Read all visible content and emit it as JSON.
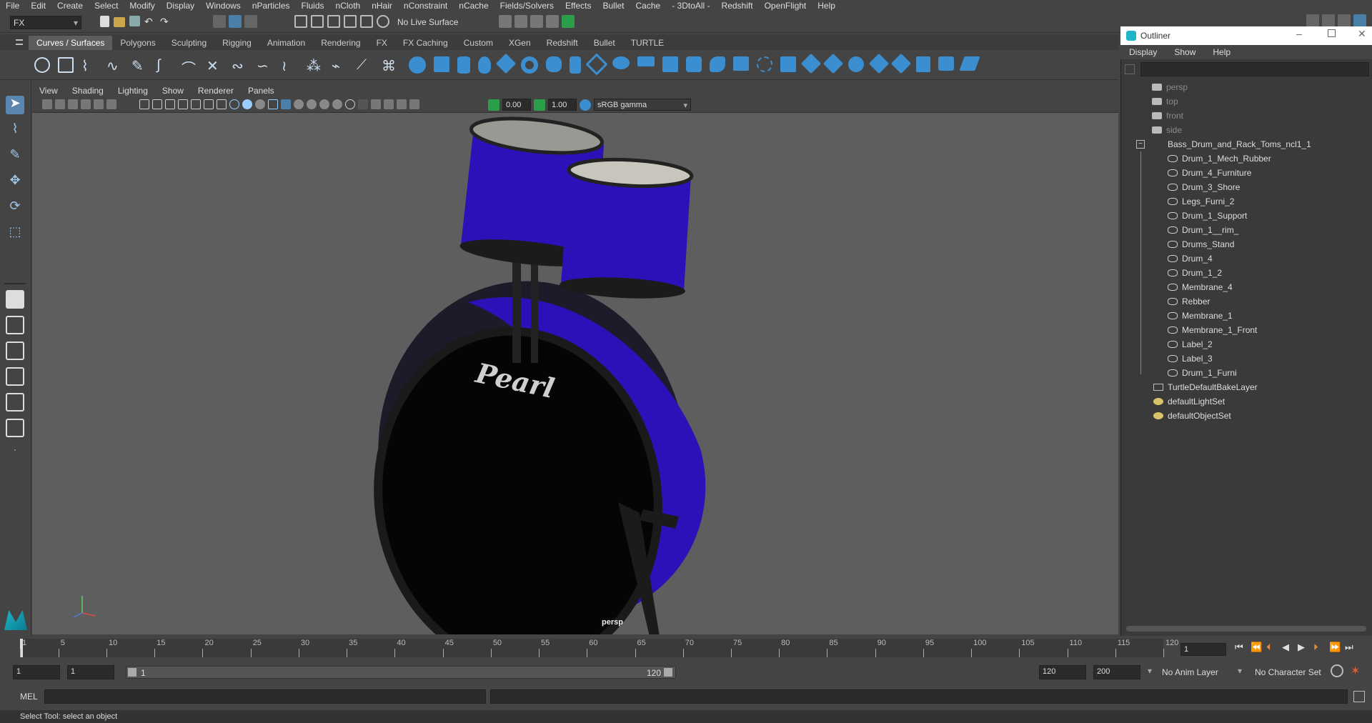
{
  "menu": {
    "items": [
      "File",
      "Edit",
      "Create",
      "Select",
      "Modify",
      "Display",
      "Windows",
      "nParticles",
      "Fluids",
      "nCloth",
      "nHair",
      "nConstraint",
      "nCache",
      "Fields/Solvers",
      "Effects",
      "Bullet",
      "Cache",
      "- 3DtoAll -",
      "Redshift",
      "OpenFlight",
      "Help"
    ]
  },
  "status": {
    "mode": "FX",
    "live_surface": "No Live Surface"
  },
  "shelf": {
    "tabs": [
      "Curves / Surfaces",
      "Polygons",
      "Sculpting",
      "Rigging",
      "Animation",
      "Rendering",
      "FX",
      "FX Caching",
      "Custom",
      "XGen",
      "Redshift",
      "Bullet",
      "TURTLE"
    ],
    "active": 0
  },
  "viewport": {
    "menu": [
      "View",
      "Shading",
      "Lighting",
      "Show",
      "Renderer",
      "Panels"
    ],
    "exposure": "0.00",
    "gamma": "1.00",
    "colorspace": "sRGB gamma",
    "camera_label": "persp",
    "logo_text": "Pearl",
    "drum_color": "#2a12b8"
  },
  "outliner": {
    "title": "Outliner",
    "menu": [
      "Display",
      "Show",
      "Help"
    ],
    "cameras": [
      "persp",
      "top",
      "front",
      "side"
    ],
    "group": "Bass_Drum_and_Rack_Toms_ncl1_1",
    "children": [
      "Drum_1_Mech_Rubber",
      "Drum_4_Furniture",
      "Drum_3_Shore",
      "Legs_Furni_2",
      "Drum_1_Support",
      "Drum_1__rim_",
      "Drums_Stand",
      "Drum_4",
      "Drum_1_2",
      "Membrane_4",
      "Rebber",
      "Membrane_1",
      "Membrane_1_Front",
      "Label_2",
      "Label_3",
      "Drum_1_Furni"
    ],
    "sets": [
      "TurtleDefaultBakeLayer",
      "defaultLightSet",
      "defaultObjectSet"
    ]
  },
  "timeline": {
    "ticks": [
      "1",
      "5",
      "10",
      "15",
      "20",
      "25",
      "30",
      "35",
      "40",
      "45",
      "50",
      "55",
      "60",
      "65",
      "70",
      "75",
      "80",
      "85",
      "90",
      "95",
      "100",
      "105",
      "110",
      "115",
      "120"
    ],
    "current_frame": "1"
  },
  "range": {
    "start": "1",
    "playback_start": "1",
    "slider_start": "1",
    "slider_end": "120",
    "playback_end": "120",
    "end": "200",
    "anim_layer": "No Anim Layer",
    "char_set": "No Character Set"
  },
  "cmd": {
    "label": "MEL"
  },
  "help": {
    "text": "Select Tool: select an object"
  }
}
